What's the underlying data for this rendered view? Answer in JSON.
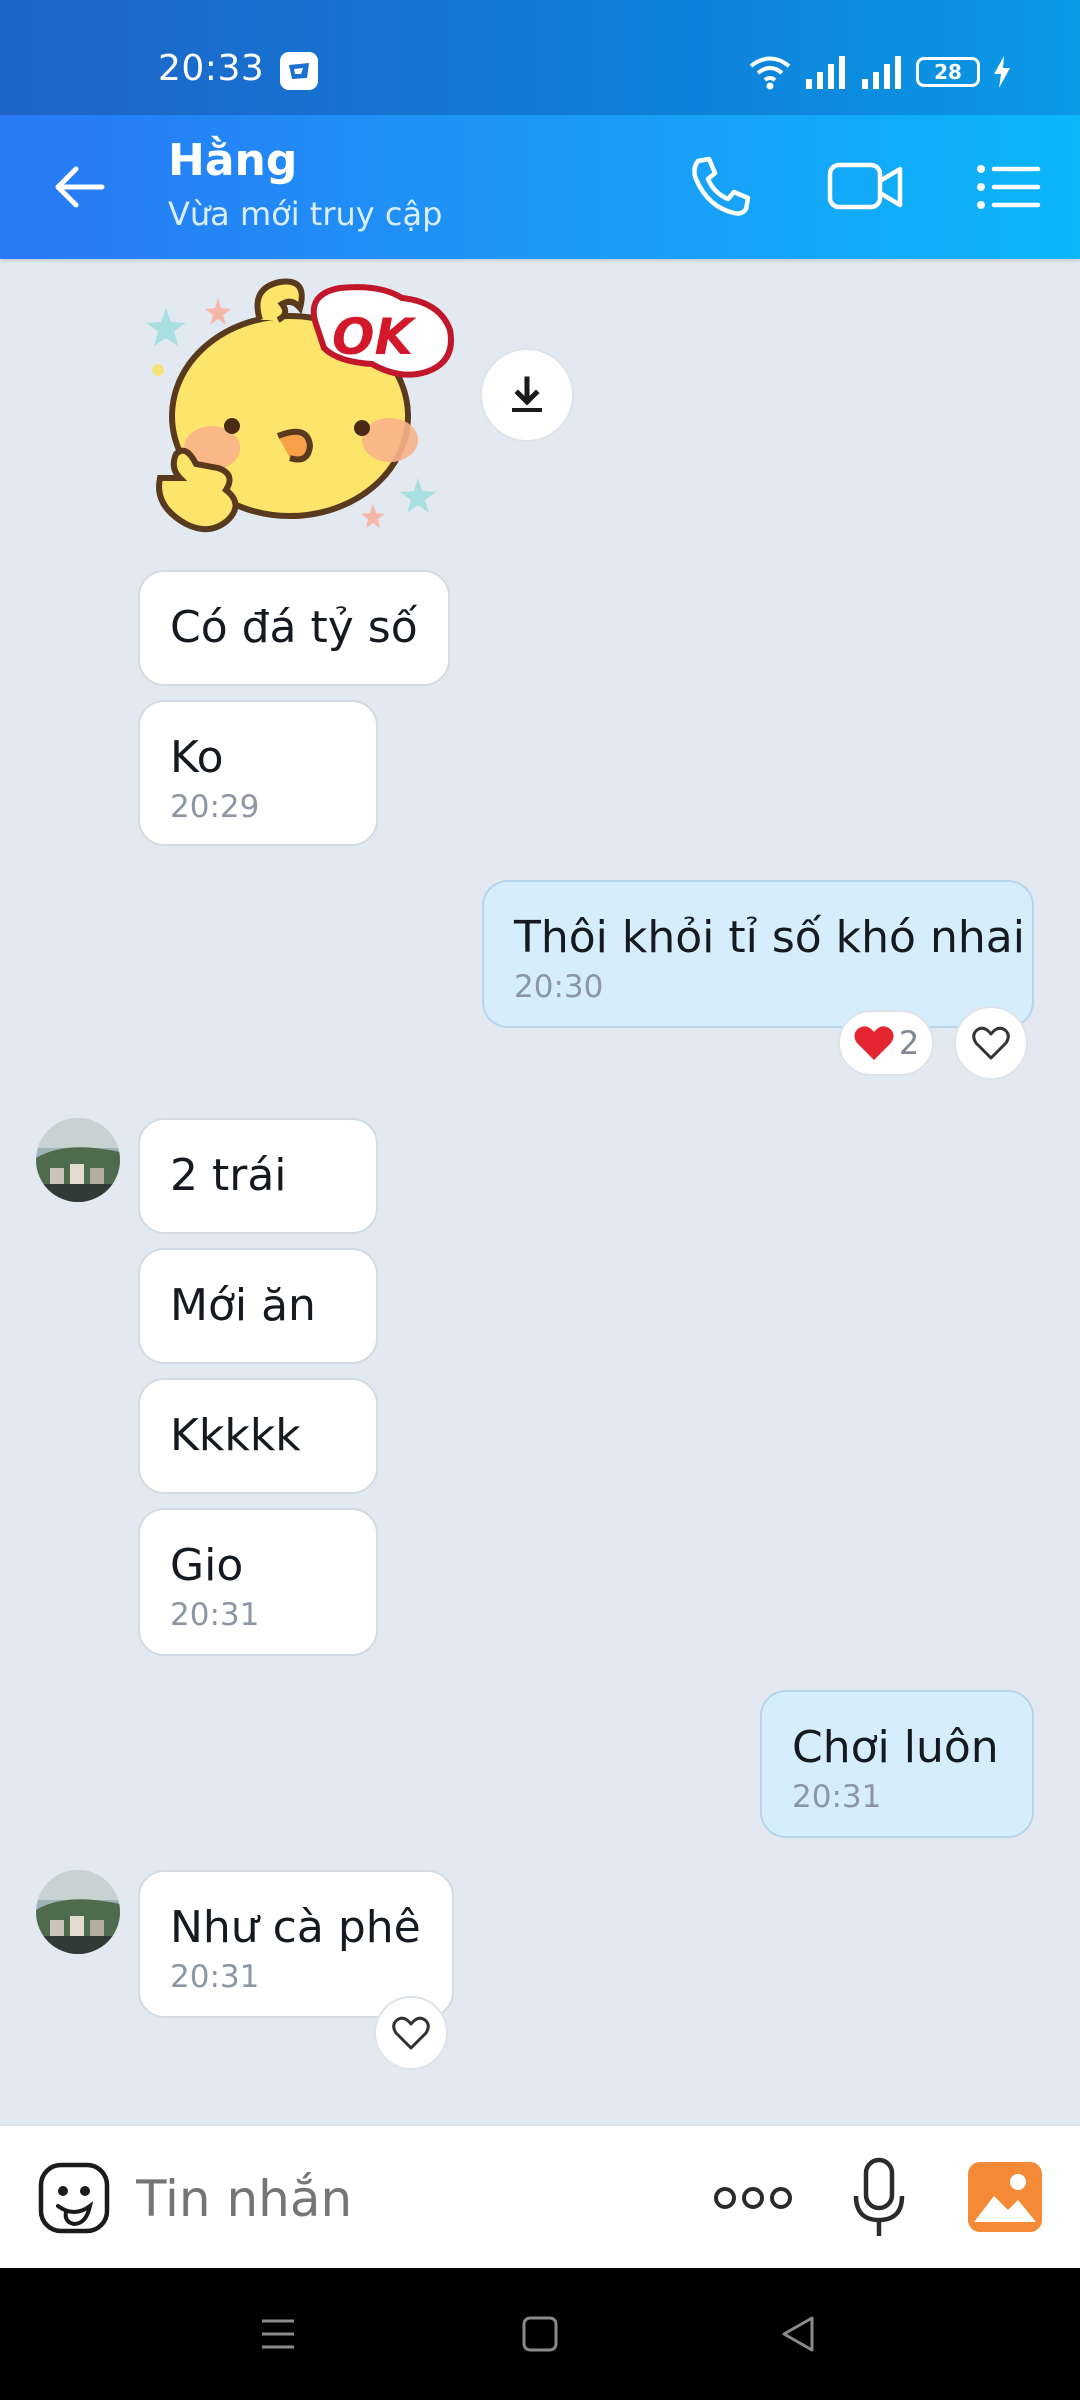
{
  "status_bar": {
    "time": "20:33",
    "battery": "28"
  },
  "header": {
    "contact_name": "Hằng",
    "presence": "Vừa mới truy cập",
    "icons": [
      "back-arrow-icon",
      "phone-icon",
      "video-call-icon",
      "menu-list-icon"
    ]
  },
  "sticker": {
    "text": "OK"
  },
  "messages": [
    {
      "text": "Có đá tỷ số"
    },
    {
      "text": "Ko",
      "time": "20:29"
    },
    {
      "text": "Thôi khỏi tỉ số khó nhai",
      "time": "20:30",
      "reaction_count": "2"
    },
    {
      "text": "2 trái"
    },
    {
      "text": "Mới ăn"
    },
    {
      "text": "Kkkkk"
    },
    {
      "text": "Gio",
      "time": "20:31"
    },
    {
      "text": "Chơi luôn",
      "time": "20:31"
    },
    {
      "text": "Như cà phê",
      "time": "20:31"
    }
  ],
  "composer": {
    "placeholder": "Tin nhắn"
  },
  "colors": {
    "header_start": "#2979f5",
    "header_end": "#0bb6f9",
    "outgoing_bubble": "#d6eefc",
    "background": "#e2e9f1"
  }
}
